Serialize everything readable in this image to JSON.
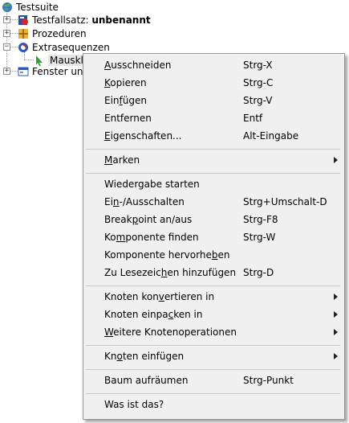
{
  "tree": {
    "root": {
      "label": "Testsuite"
    },
    "testset": {
      "prefix": "Testfallsatz: ",
      "name": "unbenannt"
    },
    "procedures": {
      "label": "Prozeduren"
    },
    "extras": {
      "label": "Extrasequenzen"
    },
    "selected": {
      "label": "Mauskli"
    },
    "windows": {
      "label": "Fenster un"
    }
  },
  "menu": {
    "cut": {
      "pre": "",
      "key": "A",
      "post": "usschneiden",
      "shortcut": "Strg-X"
    },
    "copy": {
      "pre": "",
      "key": "K",
      "post": "opieren",
      "shortcut": "Strg-C"
    },
    "paste": {
      "pre": "Ein",
      "key": "f",
      "post": "ügen",
      "shortcut": "Strg-V"
    },
    "remove": {
      "label": "Entfernen",
      "shortcut": "Entf"
    },
    "props": {
      "pre": "",
      "key": "E",
      "post": "igenschaften...",
      "shortcut": "Alt-Eingabe"
    },
    "marks": {
      "pre": "",
      "key": "M",
      "post": "arken"
    },
    "replay": {
      "label": "Wiedergabe starten"
    },
    "toggle": {
      "pre": "Ei",
      "key": "n",
      "post": "-/Ausschalten",
      "shortcut": "Strg+Umschalt-D"
    },
    "breakpoint": {
      "pre": "Break",
      "key": "p",
      "post": "oint an/aus",
      "shortcut": "Strg-F8"
    },
    "find": {
      "pre": "Ko",
      "key": "m",
      "post": "ponente finden",
      "shortcut": "Strg-W"
    },
    "highlight": {
      "pre": "Komponente hervorhe",
      "key": "b",
      "post": "en"
    },
    "bookmark": {
      "pre": "Zu Lesezeic",
      "key": "h",
      "post": "en hinzufügen",
      "shortcut": "Strg-D"
    },
    "convert": {
      "pre": "Knoten kon",
      "key": "v",
      "post": "ertieren in"
    },
    "pack": {
      "pre": "Knoten einpa",
      "key": "c",
      "post": "ken in"
    },
    "more": {
      "pre": "",
      "key": "W",
      "post": "eitere Knotenoperationen"
    },
    "insert": {
      "pre": "Kn",
      "key": "o",
      "post": "ten einfügen"
    },
    "cleanup": {
      "label": "Baum aufräumen",
      "shortcut": "Strg-Punkt"
    },
    "help": {
      "label": "Was ist das?"
    }
  }
}
